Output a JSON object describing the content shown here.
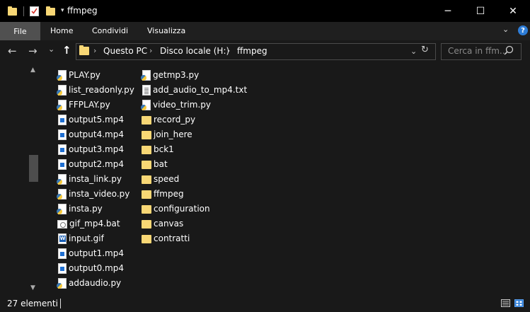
{
  "window": {
    "title": "ffmpeg",
    "controls": {
      "minimize": "─",
      "maximize": "☐",
      "close": "✕"
    }
  },
  "ribbon": {
    "file_tab": "File",
    "tabs": [
      "Home",
      "Condividi",
      "Visualizza"
    ],
    "help": "?"
  },
  "navigation": {
    "back": "←",
    "forward": "→",
    "recent": "⌄",
    "up": "↑",
    "breadcrumb": [
      "Questo PC",
      "Disco locale (H:)",
      "ffmpeg"
    ],
    "search_placeholder": "Cerca in ffm..."
  },
  "files": {
    "column1": [
      {
        "name": "PLAY.py",
        "icon": "python-file-icon"
      },
      {
        "name": "list_readonly.py",
        "icon": "python-file-icon"
      },
      {
        "name": "FFPLAY.py",
        "icon": "python-file-icon"
      },
      {
        "name": "output5.mp4",
        "icon": "video-file-icon"
      },
      {
        "name": "output4.mp4",
        "icon": "video-file-icon"
      },
      {
        "name": "output3.mp4",
        "icon": "video-file-icon"
      },
      {
        "name": "output2.mp4",
        "icon": "video-file-icon"
      },
      {
        "name": "insta_link.py",
        "icon": "python-file-icon"
      },
      {
        "name": "insta_video.py",
        "icon": "python-file-icon"
      },
      {
        "name": "insta.py",
        "icon": "python-file-icon"
      },
      {
        "name": "gif_mp4.bat",
        "icon": "batch-file-icon"
      },
      {
        "name": "input.gif",
        "icon": "gif-file-icon"
      },
      {
        "name": "output1.mp4",
        "icon": "video-file-icon"
      },
      {
        "name": "output0.mp4",
        "icon": "video-file-icon"
      },
      {
        "name": "addaudio.py",
        "icon": "python-file-icon"
      }
    ],
    "column2": [
      {
        "name": "getmp3.py",
        "icon": "python-file-icon"
      },
      {
        "name": "add_audio_to_mp4.txt",
        "icon": "text-file-icon"
      },
      {
        "name": "video_trim.py",
        "icon": "python-file-icon"
      },
      {
        "name": "record_py",
        "icon": "folder-icon"
      },
      {
        "name": "join_here",
        "icon": "folder-icon"
      },
      {
        "name": "bck1",
        "icon": "folder-icon"
      },
      {
        "name": "bat",
        "icon": "folder-icon"
      },
      {
        "name": "speed",
        "icon": "folder-icon"
      },
      {
        "name": "ffmpeg",
        "icon": "folder-icon"
      },
      {
        "name": "configuration",
        "icon": "folder-icon"
      },
      {
        "name": "canvas",
        "icon": "folder-icon"
      },
      {
        "name": "contratti",
        "icon": "folder-icon"
      }
    ]
  },
  "status": {
    "item_count": "27 elementi"
  },
  "colors": {
    "background": "#191919",
    "titlebar": "#000000",
    "folder": "#f8d775",
    "accent": "#2e7dd7"
  }
}
